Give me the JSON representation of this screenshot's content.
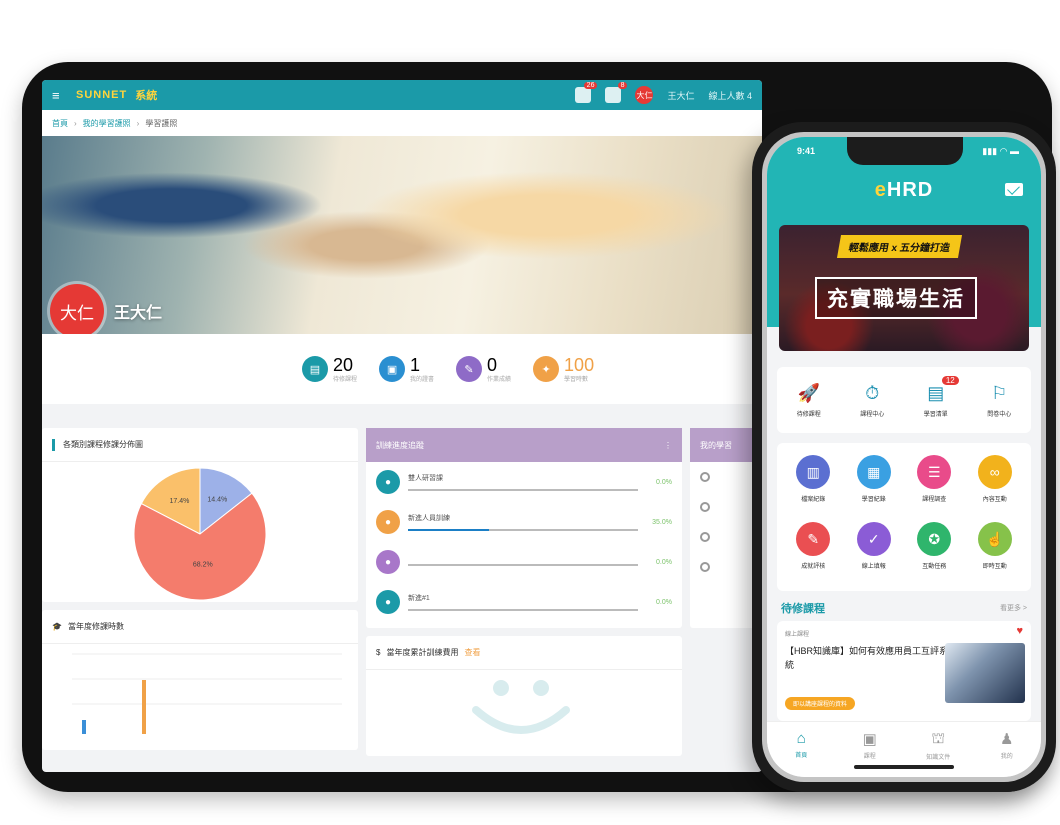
{
  "tablet": {
    "topbar": {
      "logo_text": "SUNNET",
      "logo_sub": "系統",
      "badge_1": "26",
      "badge_2": "8",
      "avatar_initials": "大仁",
      "user_name": "王大仁",
      "online_text": "線上人數 4"
    },
    "breadcrumb": [
      "首頁",
      "我的學習護照",
      "學習護照"
    ],
    "hero": {
      "avatar_text": "大仁",
      "user_name": "王大仁"
    },
    "stats": [
      {
        "value": "20",
        "label": "待修課程",
        "color": "#1b9aa8",
        "icon": "book-icon"
      },
      {
        "value": "1",
        "label": "我的證書",
        "color": "#2a8fd1",
        "icon": "file-icon"
      },
      {
        "value": "0",
        "label": "作業成績",
        "color": "#8e6bc7",
        "icon": "edit-icon"
      },
      {
        "value": "100",
        "label": "學習時數",
        "color": "#f0a147",
        "icon": "hat-icon"
      }
    ],
    "pie_card": {
      "title": "各類別課程修課分佈圖",
      "slices": [
        {
          "label": "68.2%",
          "value": 68.2,
          "color": "#f47c6c"
        },
        {
          "label": "17.4%",
          "value": 17.4,
          "color": "#fac06a"
        },
        {
          "label": "14.4%",
          "value": 14.4,
          "color": "#9db1e8"
        }
      ]
    },
    "progress_card": {
      "title": "訓練進度追蹤",
      "items": [
        {
          "title": "雙人研習課",
          "percent": 0,
          "pct_label": "0.0%",
          "color": "#1b9aa8"
        },
        {
          "title": "新進人員訓練",
          "percent": 35,
          "pct_label": "35.0%",
          "color": "#f0a147"
        },
        {
          "title": "",
          "percent": 0,
          "pct_label": "0.0%",
          "color": "#a877c9"
        },
        {
          "title": "新進#1",
          "percent": 0,
          "pct_label": "0.0%",
          "color": "#1b9aa8"
        }
      ]
    },
    "side_card": {
      "title": "我的學習"
    },
    "yearly_card": {
      "title": "當年度修課時數"
    },
    "budget_card": {
      "title": "當年度累計訓練費用",
      "tag": "查看"
    }
  },
  "phone": {
    "time": "9:41",
    "signal": "▮▮▮ ◠ ▬",
    "brand_e": "e",
    "brand_rest": "HRD",
    "banner_tag": "輕鬆應用 x 五分鐘打造",
    "banner_title": "充實職場生活",
    "quick": [
      {
        "label": "待修課程",
        "icon": "rocket-icon",
        "glyph": "🚀"
      },
      {
        "label": "課程中心",
        "icon": "timer-icon",
        "glyph": "⏱"
      },
      {
        "label": "學習清單",
        "icon": "books-icon",
        "glyph": "▤",
        "badge": "12"
      },
      {
        "label": "問卷中心",
        "icon": "stamp-icon",
        "glyph": "⚐"
      }
    ],
    "grid": [
      {
        "label": "檔案紀錄",
        "color": "#5b6fd1",
        "glyph": "▥",
        "icon": "file-history-icon"
      },
      {
        "label": "學習紀錄",
        "color": "#3aa0e2",
        "glyph": "▦",
        "icon": "calendar-icon"
      },
      {
        "label": "課程調查",
        "color": "#e94b8a",
        "glyph": "☰",
        "icon": "survey-icon"
      },
      {
        "label": "內容互動",
        "color": "#f2b21c",
        "glyph": "∞",
        "icon": "link-icon"
      },
      {
        "label": "成就評核",
        "color": "#ea4f52",
        "glyph": "✎",
        "icon": "pen-icon"
      },
      {
        "label": "線上填報",
        "color": "#8b5cd6",
        "glyph": "✓",
        "icon": "check-icon"
      },
      {
        "label": "互動任務",
        "color": "#2fb56c",
        "glyph": "✪",
        "icon": "award-icon"
      },
      {
        "label": "即時互動",
        "color": "#86c24a",
        "glyph": "☝",
        "icon": "touch-icon"
      }
    ],
    "section_title": "待修課程",
    "section_more": "看更多 >",
    "course": {
      "tag": "線上課程",
      "title": "【HBR知識庫】如何有效應用員工互評系統",
      "label": "即以講座課程的資料"
    },
    "tabs": [
      {
        "label": "首頁",
        "glyph": "⌂",
        "icon": "home-icon",
        "active": true
      },
      {
        "label": "課程",
        "glyph": "▣",
        "icon": "course-icon",
        "active": false
      },
      {
        "label": "知識文件",
        "glyph": "⛫",
        "icon": "library-icon",
        "active": false
      },
      {
        "label": "我的",
        "glyph": "♟",
        "icon": "person-icon",
        "active": false
      }
    ]
  }
}
